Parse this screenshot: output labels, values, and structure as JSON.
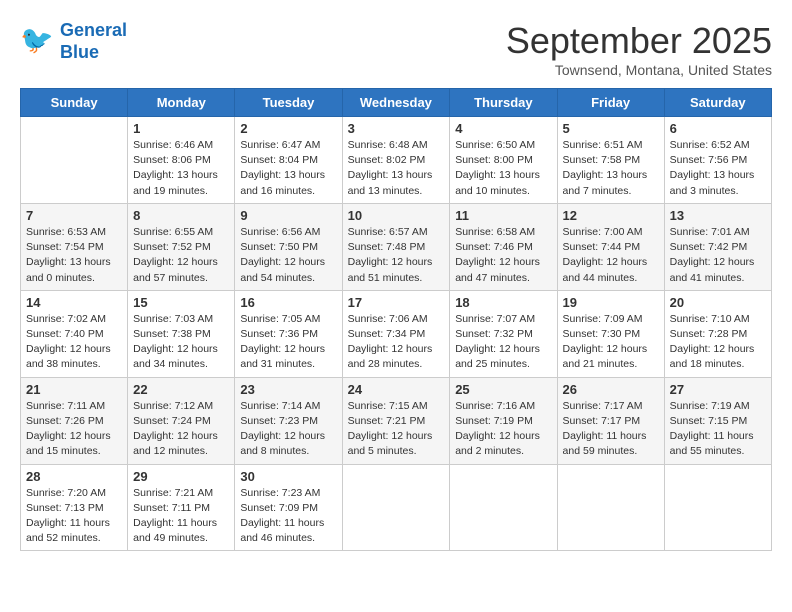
{
  "header": {
    "logo_line1": "General",
    "logo_line2": "Blue",
    "month": "September 2025",
    "location": "Townsend, Montana, United States"
  },
  "days_of_week": [
    "Sunday",
    "Monday",
    "Tuesday",
    "Wednesday",
    "Thursday",
    "Friday",
    "Saturday"
  ],
  "weeks": [
    [
      {
        "day": "",
        "sunrise": "",
        "sunset": "",
        "daylight": ""
      },
      {
        "day": "1",
        "sunrise": "Sunrise: 6:46 AM",
        "sunset": "Sunset: 8:06 PM",
        "daylight": "Daylight: 13 hours and 19 minutes."
      },
      {
        "day": "2",
        "sunrise": "Sunrise: 6:47 AM",
        "sunset": "Sunset: 8:04 PM",
        "daylight": "Daylight: 13 hours and 16 minutes."
      },
      {
        "day": "3",
        "sunrise": "Sunrise: 6:48 AM",
        "sunset": "Sunset: 8:02 PM",
        "daylight": "Daylight: 13 hours and 13 minutes."
      },
      {
        "day": "4",
        "sunrise": "Sunrise: 6:50 AM",
        "sunset": "Sunset: 8:00 PM",
        "daylight": "Daylight: 13 hours and 10 minutes."
      },
      {
        "day": "5",
        "sunrise": "Sunrise: 6:51 AM",
        "sunset": "Sunset: 7:58 PM",
        "daylight": "Daylight: 13 hours and 7 minutes."
      },
      {
        "day": "6",
        "sunrise": "Sunrise: 6:52 AM",
        "sunset": "Sunset: 7:56 PM",
        "daylight": "Daylight: 13 hours and 3 minutes."
      }
    ],
    [
      {
        "day": "7",
        "sunrise": "Sunrise: 6:53 AM",
        "sunset": "Sunset: 7:54 PM",
        "daylight": "Daylight: 13 hours and 0 minutes."
      },
      {
        "day": "8",
        "sunrise": "Sunrise: 6:55 AM",
        "sunset": "Sunset: 7:52 PM",
        "daylight": "Daylight: 12 hours and 57 minutes."
      },
      {
        "day": "9",
        "sunrise": "Sunrise: 6:56 AM",
        "sunset": "Sunset: 7:50 PM",
        "daylight": "Daylight: 12 hours and 54 minutes."
      },
      {
        "day": "10",
        "sunrise": "Sunrise: 6:57 AM",
        "sunset": "Sunset: 7:48 PM",
        "daylight": "Daylight: 12 hours and 51 minutes."
      },
      {
        "day": "11",
        "sunrise": "Sunrise: 6:58 AM",
        "sunset": "Sunset: 7:46 PM",
        "daylight": "Daylight: 12 hours and 47 minutes."
      },
      {
        "day": "12",
        "sunrise": "Sunrise: 7:00 AM",
        "sunset": "Sunset: 7:44 PM",
        "daylight": "Daylight: 12 hours and 44 minutes."
      },
      {
        "day": "13",
        "sunrise": "Sunrise: 7:01 AM",
        "sunset": "Sunset: 7:42 PM",
        "daylight": "Daylight: 12 hours and 41 minutes."
      }
    ],
    [
      {
        "day": "14",
        "sunrise": "Sunrise: 7:02 AM",
        "sunset": "Sunset: 7:40 PM",
        "daylight": "Daylight: 12 hours and 38 minutes."
      },
      {
        "day": "15",
        "sunrise": "Sunrise: 7:03 AM",
        "sunset": "Sunset: 7:38 PM",
        "daylight": "Daylight: 12 hours and 34 minutes."
      },
      {
        "day": "16",
        "sunrise": "Sunrise: 7:05 AM",
        "sunset": "Sunset: 7:36 PM",
        "daylight": "Daylight: 12 hours and 31 minutes."
      },
      {
        "day": "17",
        "sunrise": "Sunrise: 7:06 AM",
        "sunset": "Sunset: 7:34 PM",
        "daylight": "Daylight: 12 hours and 28 minutes."
      },
      {
        "day": "18",
        "sunrise": "Sunrise: 7:07 AM",
        "sunset": "Sunset: 7:32 PM",
        "daylight": "Daylight: 12 hours and 25 minutes."
      },
      {
        "day": "19",
        "sunrise": "Sunrise: 7:09 AM",
        "sunset": "Sunset: 7:30 PM",
        "daylight": "Daylight: 12 hours and 21 minutes."
      },
      {
        "day": "20",
        "sunrise": "Sunrise: 7:10 AM",
        "sunset": "Sunset: 7:28 PM",
        "daylight": "Daylight: 12 hours and 18 minutes."
      }
    ],
    [
      {
        "day": "21",
        "sunrise": "Sunrise: 7:11 AM",
        "sunset": "Sunset: 7:26 PM",
        "daylight": "Daylight: 12 hours and 15 minutes."
      },
      {
        "day": "22",
        "sunrise": "Sunrise: 7:12 AM",
        "sunset": "Sunset: 7:24 PM",
        "daylight": "Daylight: 12 hours and 12 minutes."
      },
      {
        "day": "23",
        "sunrise": "Sunrise: 7:14 AM",
        "sunset": "Sunset: 7:23 PM",
        "daylight": "Daylight: 12 hours and 8 minutes."
      },
      {
        "day": "24",
        "sunrise": "Sunrise: 7:15 AM",
        "sunset": "Sunset: 7:21 PM",
        "daylight": "Daylight: 12 hours and 5 minutes."
      },
      {
        "day": "25",
        "sunrise": "Sunrise: 7:16 AM",
        "sunset": "Sunset: 7:19 PM",
        "daylight": "Daylight: 12 hours and 2 minutes."
      },
      {
        "day": "26",
        "sunrise": "Sunrise: 7:17 AM",
        "sunset": "Sunset: 7:17 PM",
        "daylight": "Daylight: 11 hours and 59 minutes."
      },
      {
        "day": "27",
        "sunrise": "Sunrise: 7:19 AM",
        "sunset": "Sunset: 7:15 PM",
        "daylight": "Daylight: 11 hours and 55 minutes."
      }
    ],
    [
      {
        "day": "28",
        "sunrise": "Sunrise: 7:20 AM",
        "sunset": "Sunset: 7:13 PM",
        "daylight": "Daylight: 11 hours and 52 minutes."
      },
      {
        "day": "29",
        "sunrise": "Sunrise: 7:21 AM",
        "sunset": "Sunset: 7:11 PM",
        "daylight": "Daylight: 11 hours and 49 minutes."
      },
      {
        "day": "30",
        "sunrise": "Sunrise: 7:23 AM",
        "sunset": "Sunset: 7:09 PM",
        "daylight": "Daylight: 11 hours and 46 minutes."
      },
      {
        "day": "",
        "sunrise": "",
        "sunset": "",
        "daylight": ""
      },
      {
        "day": "",
        "sunrise": "",
        "sunset": "",
        "daylight": ""
      },
      {
        "day": "",
        "sunrise": "",
        "sunset": "",
        "daylight": ""
      },
      {
        "day": "",
        "sunrise": "",
        "sunset": "",
        "daylight": ""
      }
    ]
  ]
}
